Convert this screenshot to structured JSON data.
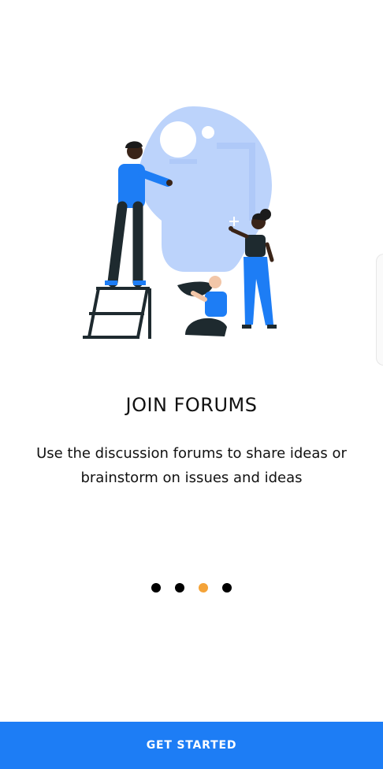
{
  "onboarding": {
    "title": "JOIN FORUMS",
    "description": "Use the discussion forums to share ideas or brainstorm on issues and ideas",
    "pager": {
      "total": 4,
      "active_index": 2
    },
    "cta_label": "GET STARTED"
  },
  "colors": {
    "accent": "#1d7df5",
    "dot_active": "#f4a338",
    "dot_inactive": "#000000",
    "illustration_blue": "#bcd3fb"
  },
  "illustration": {
    "icon": "forum-collaboration-illustration"
  }
}
